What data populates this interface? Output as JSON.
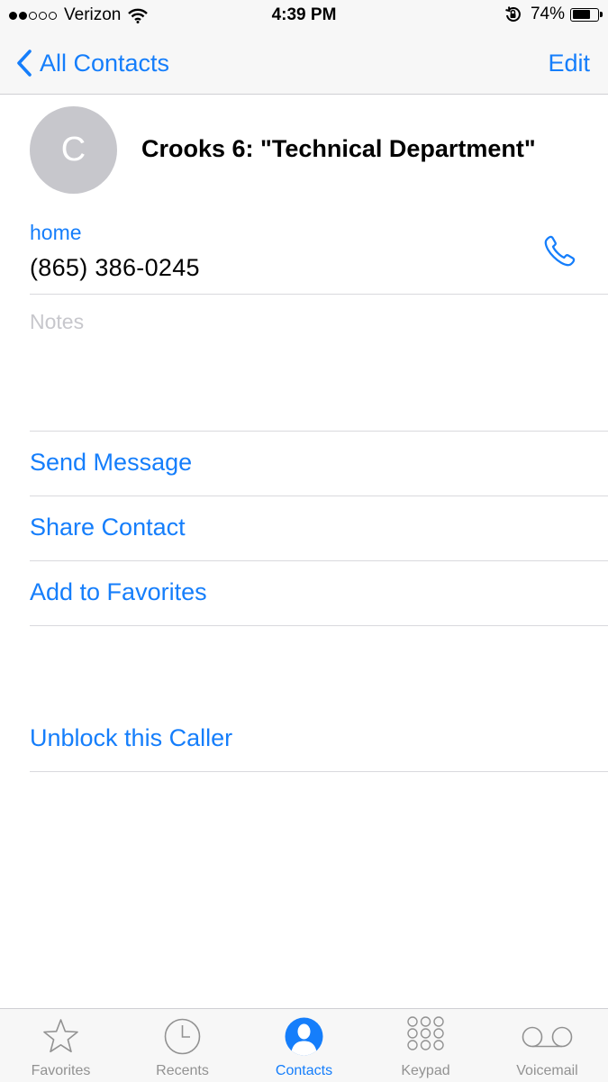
{
  "status_bar": {
    "carrier": "Verizon",
    "time": "4:39 PM",
    "battery": "74%",
    "battery_level": 0.74,
    "signal_bars_filled": 2,
    "signal_bars_total": 5
  },
  "nav": {
    "back_label": "All Contacts",
    "edit_label": "Edit"
  },
  "contact": {
    "initial": "C",
    "name": "Crooks 6: \"Technical Department\"",
    "phone_label": "home",
    "phone_number": "(865) 386-0245",
    "notes_placeholder": "Notes"
  },
  "actions": {
    "send_message": "Send Message",
    "share_contact": "Share Contact",
    "add_favorites": "Add to Favorites",
    "unblock": "Unblock this Caller"
  },
  "tabs": [
    {
      "label": "Favorites",
      "icon": "star-icon",
      "active": false
    },
    {
      "label": "Recents",
      "icon": "clock-icon",
      "active": false
    },
    {
      "label": "Contacts",
      "icon": "person-icon",
      "active": true
    },
    {
      "label": "Keypad",
      "icon": "keypad-icon",
      "active": false
    },
    {
      "label": "Voicemail",
      "icon": "voicemail-icon",
      "active": false
    }
  ],
  "colors": {
    "accent": "#157efb",
    "avatar_bg": "#c7c7cc",
    "inactive_tab": "#929292"
  }
}
